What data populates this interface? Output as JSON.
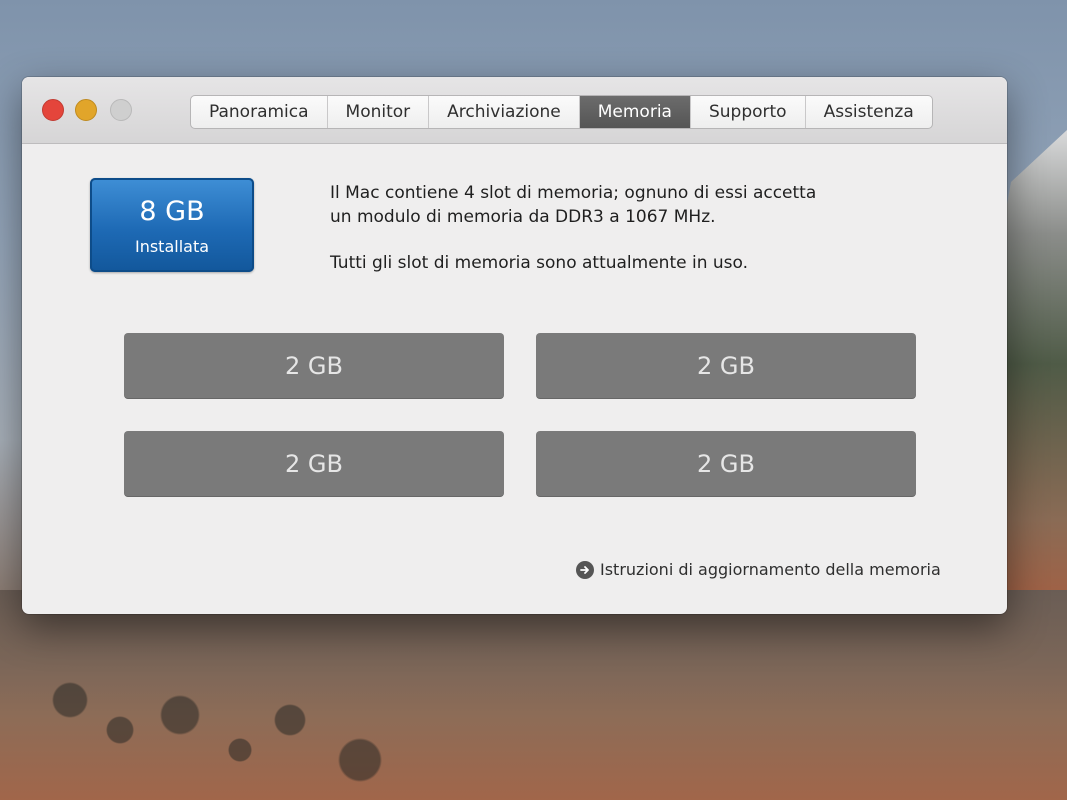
{
  "tabs": [
    "Panoramica",
    "Monitor",
    "Archiviazione",
    "Memoria",
    "Supporto",
    "Assistenza"
  ],
  "active_tab": "Memoria",
  "memory": {
    "installed_amount": "8 GB",
    "installed_label": "Installata",
    "description_line1": "Il Mac contiene 4 slot di memoria; ognuno di essi accetta",
    "description_line2": "un modulo di memoria da DDR3 a 1067 MHz.",
    "status": "Tutti gli slot di memoria sono attualmente in uso.",
    "slots": [
      "2 GB",
      "2 GB",
      "2 GB",
      "2 GB"
    ]
  },
  "upgrade_link": "Istruzioni di aggiornamento della memoria",
  "colors": {
    "accent_blue": "#1e6ab5",
    "slot_gray": "#7a7a7a",
    "close": "#e4453b",
    "minimize": "#e1a52a",
    "zoom_disabled": "#cfcfcf"
  }
}
